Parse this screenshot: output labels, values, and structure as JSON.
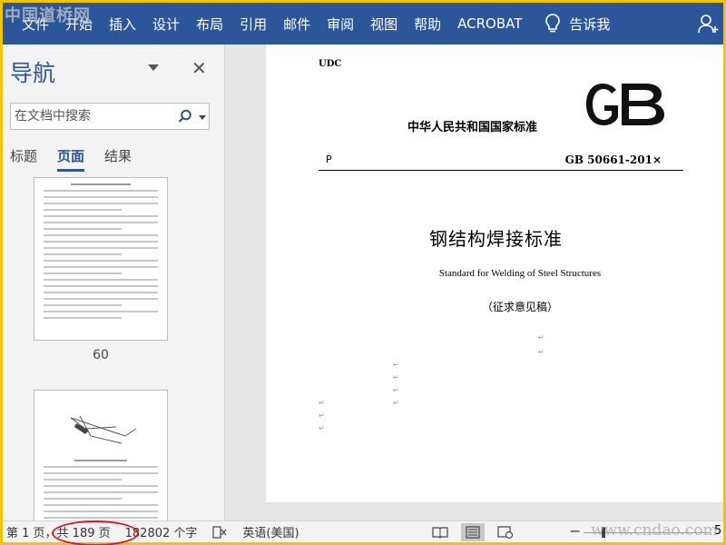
{
  "ribbon": {
    "tabs": [
      "文件",
      "开始",
      "插入",
      "设计",
      "布局",
      "引用",
      "邮件",
      "审阅",
      "视图",
      "帮助",
      "ACROBAT"
    ],
    "tell_me": "告诉我"
  },
  "watermark": {
    "top": "中国道桥网",
    "bottom": "www.cndao.com"
  },
  "nav": {
    "title": "导航",
    "search_placeholder": "在文档中搜索",
    "tabs": [
      "标题",
      "页面",
      "结果"
    ],
    "active_tab": "页面",
    "thumbnails": [
      {
        "label": "60"
      }
    ]
  },
  "document": {
    "udc": "UDC",
    "gb_logo": "GB",
    "country_std": "中华人民共和国国家标准",
    "ccs": "P",
    "std_number": "GB 50661-201×",
    "title_cn": "钢结构焊接标准",
    "title_en": "Standard for Welding of Steel Structures",
    "status": "（征求意见稿）"
  },
  "statusbar": {
    "page": "第 1 页，",
    "total": "共 189 页",
    "words": "182802 个字",
    "language": "英语(美国)",
    "zoom": "5"
  },
  "icons": {
    "search": "search-icon",
    "close": "close-icon",
    "lightbulb": "lightbulb-icon",
    "user": "user-icon",
    "proofing": "proofing-icon",
    "read_mode": "read-mode-icon",
    "print_layout": "print-layout-icon",
    "web_layout": "web-layout-icon"
  },
  "colors": {
    "ribbon": "#2b579a",
    "highlight_circle": "#e0141e",
    "border": "#f5c400"
  }
}
